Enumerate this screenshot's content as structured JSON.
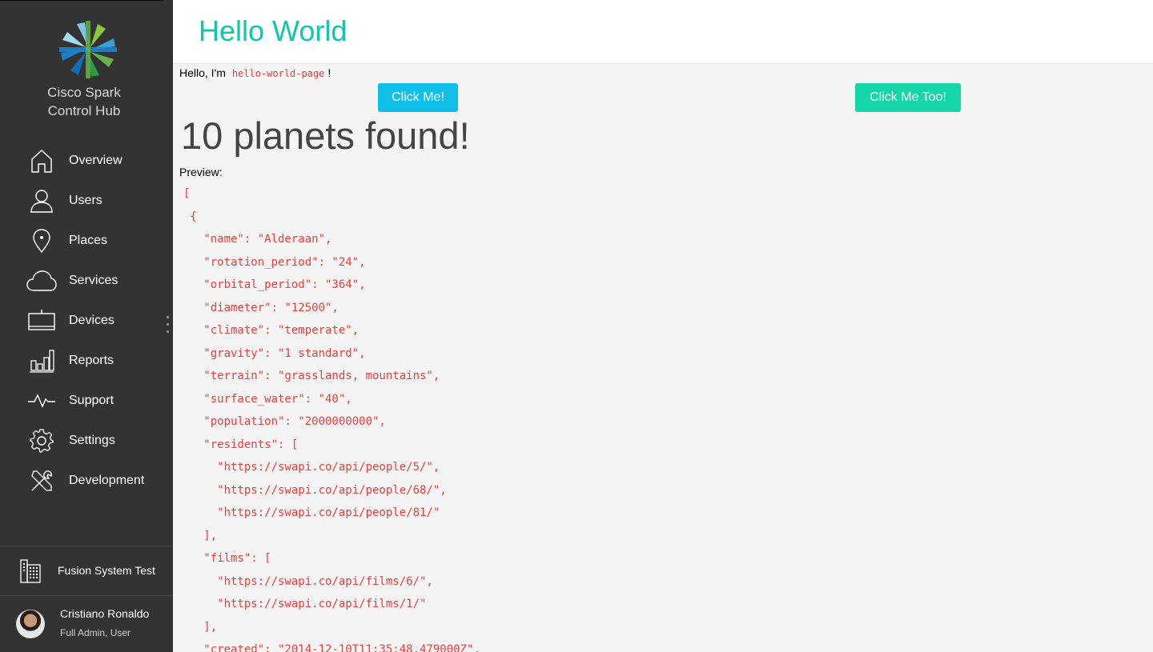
{
  "sidebar": {
    "brand_line1": "Cisco Spark",
    "brand_line2": "Control Hub",
    "items": [
      {
        "label": "Overview",
        "icon": "home-icon"
      },
      {
        "label": "Users",
        "icon": "user-icon"
      },
      {
        "label": "Places",
        "icon": "location-pin-icon"
      },
      {
        "label": "Services",
        "icon": "cloud-icon"
      },
      {
        "label": "Devices",
        "icon": "device-icon"
      },
      {
        "label": "Reports",
        "icon": "bar-chart-icon"
      },
      {
        "label": "Support",
        "icon": "pulse-icon"
      },
      {
        "label": "Settings",
        "icon": "gear-icon"
      },
      {
        "label": "Development",
        "icon": "tools-icon"
      }
    ],
    "org_name": "Fusion System Test",
    "user_name": "Cristiano Ronaldo",
    "user_role": "Full Admin, User"
  },
  "header": {
    "title": "Hello World"
  },
  "main": {
    "hello_prefix": "Hello, I'm",
    "hello_code": "hello-world-page",
    "hello_suffix": "!",
    "button1_label": "Click Me!",
    "button2_label": "Click Me Too!",
    "found_text": "10 planets found!",
    "preview_label": "Preview:",
    "json_lines": [
      "[",
      " {",
      "   \"name\": \"Alderaan\",",
      "   \"rotation_period\": \"24\",",
      "   \"orbital_period\": \"364\",",
      "   \"diameter\": \"12500\",",
      "   \"climate\": \"temperate\",",
      "   \"gravity\": \"1 standard\",",
      "   \"terrain\": \"grasslands, mountains\",",
      "   \"surface_water\": \"40\",",
      "   \"population\": \"2000000000\",",
      "   \"residents\": [",
      "     \"https://swapi.co/api/people/5/\",",
      "     \"https://swapi.co/api/people/68/\",",
      "     \"https://swapi.co/api/people/81/\"",
      "   ],",
      "   \"films\": [",
      "     \"https://swapi.co/api/films/6/\",",
      "     \"https://swapi.co/api/films/1/\"",
      "   ],",
      "   \"created\": \"2014-12-10T11:35:48.479000Z\","
    ]
  },
  "colors": {
    "sidebar_bg": "#333333",
    "accent_title": "#14c6a8",
    "button1": "#0fbfe8",
    "button2": "#14d6a6",
    "code_red": "#e83e3e"
  }
}
